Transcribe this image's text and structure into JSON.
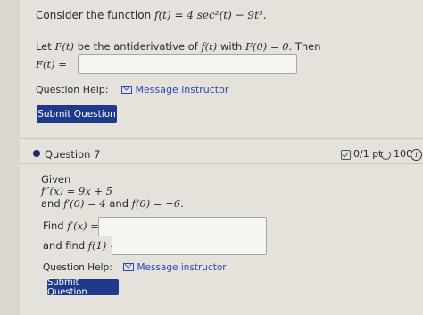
{
  "q6": {
    "intro_text": "Consider the function",
    "function_expr": "f(t) = 4 sec²(t) − 9t³.",
    "antideriv_text_1": "Let",
    "antideriv_F": "F(t)",
    "antideriv_text_2": "be the antiderivative of",
    "antideriv_f": "f(t)",
    "antideriv_text_3": "with",
    "antideriv_cond": "F(0) = 0.",
    "antideriv_text_4": "Then",
    "answer_label": "F(t) =",
    "answer_value": "",
    "help_label": "Question Help:",
    "message_link": "Message instructor",
    "submit_label": "Submit Question"
  },
  "q7": {
    "title": "Question 7",
    "score": "0/1 pt",
    "retries": "100",
    "given_label": "Given",
    "given_expr": "f′′(x) = 9x + 5",
    "cond_text_1": "and",
    "cond_expr_1": "f′(0) = 4",
    "cond_text_2": "and",
    "cond_expr_2": "f(0) = −6.",
    "find1_text": "Find",
    "find1_expr": "f′(x) =",
    "find1_value": "",
    "find2_text": "and find",
    "find2_expr": "f(1) =",
    "find2_value": "",
    "help_label": "Question Help:",
    "message_link": "Message instructor",
    "submit_label": "Submit Question"
  },
  "icons": {
    "mail": "mail-icon",
    "score": "score-check-icon",
    "retry": "retry-icon",
    "info": "info-icon"
  },
  "colors": {
    "submit_button": "#1f3a8a",
    "link": "#2b47b5",
    "question_dot": "#1c2b63"
  }
}
